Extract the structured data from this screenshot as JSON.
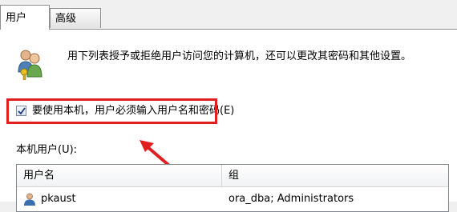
{
  "tabs": [
    {
      "label": "用户",
      "selected": true
    },
    {
      "label": "高级",
      "selected": false
    }
  ],
  "description": "用下列表授予或拒绝用户访问您的计算机，还可以更改其密码和其他设置。",
  "require_login": {
    "label": "要使用本机，用户必须输入用户名和密码(E)",
    "checked": true
  },
  "local_users": {
    "label": "本机用户(U):",
    "columns": [
      "用户名",
      "组"
    ],
    "rows": [
      {
        "name": "pkaust",
        "group": "ora_dba; Administrators"
      }
    ]
  },
  "colors": {
    "highlight": "#e02020",
    "arrow": "#e02020"
  }
}
